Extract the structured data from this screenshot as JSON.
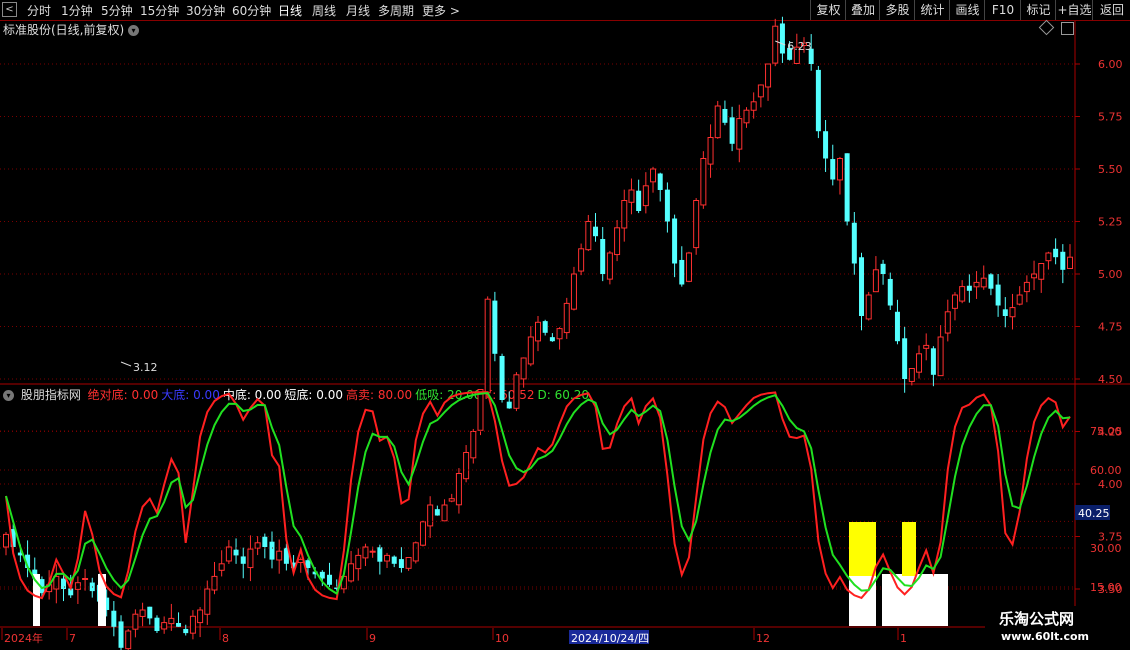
{
  "toolbar": {
    "back_glyph": "<",
    "periods": [
      "分时",
      "1分钟",
      "5分钟",
      "15分钟",
      "30分钟",
      "60分钟",
      "日线",
      "周线",
      "月线",
      "多周期",
      "更多 >"
    ],
    "active_period": "日线",
    "right_buttons": [
      "复权",
      "叠加",
      "多股",
      "统计",
      "画线",
      "F10",
      "标记",
      "+自选",
      "返回"
    ]
  },
  "main_chart": {
    "title": "标准股份(日线,前复权)",
    "price_ticks": [
      "6.00",
      "5.75",
      "5.50",
      "5.25",
      "5.00",
      "4.75",
      "4.50",
      "4.25",
      "4.00",
      "3.75",
      "3.50"
    ],
    "high_label": "6.23",
    "low_label": "3.12"
  },
  "indicator": {
    "name": "股朋指标网",
    "params": [
      {
        "label": "绝对底:",
        "value": "0.00",
        "color": "#ff3030"
      },
      {
        "label": "大底:",
        "value": "0.00",
        "color": "#3a3aff"
      },
      {
        "label": "中底:",
        "value": "0.00",
        "color": "#ffffff"
      },
      {
        "label": "短底:",
        "value": "0.00",
        "color": "#ffffff"
      },
      {
        "label": "高卖:",
        "value": "80.00",
        "color": "#ff3030"
      },
      {
        "label": "低吸:",
        "value": "20.00",
        "color": "#30e030"
      },
      {
        "label": "K:",
        "value": "60.52",
        "color": "#ff3030"
      },
      {
        "label": "D:",
        "value": "60.20",
        "color": "#30e030"
      }
    ],
    "ticks": [
      "75.00",
      "60.00",
      "30.00",
      "15.00"
    ],
    "current_value": "40.25"
  },
  "date_axis": {
    "labels": [
      "2024年",
      "7",
      "8",
      "9",
      "10",
      "12",
      "1"
    ],
    "highlight": "2024/10/24/四"
  },
  "watermark": {
    "line1": "乐淘公式网",
    "line2": "www.60lt.com"
  },
  "colors": {
    "up": "#ff3030",
    "down": "#54ffff",
    "k_line": "#ff2020",
    "d_line": "#20e020",
    "yellow": "#ffff00",
    "grid": "#7a0000"
  },
  "chart_data": {
    "type": "candlestick",
    "title": "标准股份(日线,前复权)",
    "y_range": [
      3.3,
      6.3
    ],
    "high": 6.23,
    "low": 3.12,
    "closes": [
      3.76,
      3.7,
      3.66,
      3.6,
      3.55,
      3.48,
      3.52,
      3.56,
      3.5,
      3.47,
      3.53,
      3.55,
      3.49,
      3.44,
      3.4,
      3.32,
      3.22,
      3.3,
      3.38,
      3.4,
      3.36,
      3.3,
      3.34,
      3.36,
      3.32,
      3.29,
      3.37,
      3.4,
      3.5,
      3.56,
      3.62,
      3.7,
      3.66,
      3.62,
      3.69,
      3.72,
      3.7,
      3.64,
      3.68,
      3.62,
      3.6,
      3.64,
      3.6,
      3.57,
      3.55,
      3.52,
      3.5,
      3.56,
      3.62,
      3.66,
      3.7,
      3.68,
      3.63,
      3.66,
      3.62,
      3.6,
      3.65,
      3.72,
      3.82,
      3.9,
      3.85,
      3.9,
      3.93,
      4.05,
      4.15,
      4.25,
      4.45,
      4.88,
      4.62,
      4.4,
      4.36,
      4.52,
      4.6,
      4.7,
      4.77,
      4.72,
      4.68,
      4.74,
      4.86,
      5.0,
      5.12,
      5.25,
      5.18,
      5.0,
      5.1,
      5.22,
      5.35,
      5.4,
      5.3,
      5.42,
      5.5,
      5.4,
      5.25,
      5.05,
      4.95,
      5.1,
      5.35,
      5.55,
      5.65,
      5.8,
      5.72,
      5.62,
      5.74,
      5.78,
      5.82,
      5.9,
      6.0,
      6.18,
      6.05,
      6.02,
      6.08,
      6.1,
      6.0,
      5.68,
      5.55,
      5.45,
      5.55,
      5.25,
      5.05,
      4.8,
      4.9,
      5.02,
      5.0,
      4.85,
      4.68,
      4.5,
      4.55,
      4.62,
      4.66,
      4.52,
      4.7,
      4.82,
      4.9,
      4.94,
      4.92,
      4.96,
      4.98,
      4.93,
      4.85,
      4.8,
      4.84,
      4.9,
      4.96,
      5.0,
      5.05,
      5.1,
      5.08,
      5.02,
      5.08
    ]
  }
}
